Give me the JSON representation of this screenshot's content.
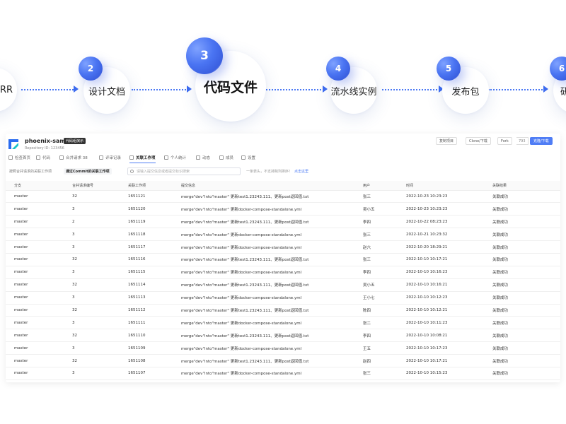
{
  "steps": [
    {
      "number": "",
      "label": "RR"
    },
    {
      "number": "2",
      "label": "设计文档"
    },
    {
      "number": "3",
      "label": "代码文件"
    },
    {
      "number": "4",
      "label": "流水线实例"
    },
    {
      "number": "5",
      "label": "发布包"
    },
    {
      "number": "6",
      "label": "研"
    }
  ],
  "repo": {
    "name": "phoenix-sample",
    "badge": "代码组演示",
    "id_text": "Repository ID: 123456"
  },
  "header_buttons": {
    "b1": "复制项目",
    "b2": "Clone/下载",
    "fork": "Fork",
    "fork_count": "793",
    "primary": "克隆/下载"
  },
  "tabs": [
    "检查首页",
    "代码",
    "合并请求 38",
    "评审记录",
    "关联工作项",
    "个人统计",
    "动态",
    "成员",
    "设置"
  ],
  "filters": {
    "seg1": "按照合并请求的关联工作项",
    "seg2": "通过Commit的关联工作项",
    "search_placeholder": "请输入提交信息或者提交标识搜索",
    "hint": "一条表头，不支持跨列排序！",
    "hint_link": "点击这里"
  },
  "table": {
    "columns": [
      "分支",
      "合并请求编号",
      "关联工作项",
      "提交信息",
      "用户",
      "时间",
      "关联结果"
    ],
    "rows": [
      [
        "master",
        "32",
        "1651121",
        "merge\"dev\"into\"master\" 更新test1.23243.111、更新post返回值.txt",
        "张三",
        "2022-10-23 10:23:23",
        "关联成功"
      ],
      [
        "master",
        "3",
        "1651120",
        "merge\"dev\"into\"master\" 更新docker-compose-standalone.yml",
        "吴小五",
        "2022-10-23 10:23:23",
        "关联成功"
      ],
      [
        "master",
        "2",
        "1651119",
        "merge\"dev\"into\"master\" 更新test1.23243.111、更新post返回值.txt",
        "李四",
        "2022-10-22 08:23:23",
        "关联成功"
      ],
      [
        "master",
        "3",
        "1651118",
        "merge\"dev\"into\"master\" 更新docker-compose-standalone.yml",
        "张三",
        "2022-10-21 10:23:32",
        "关联成功"
      ],
      [
        "master",
        "3",
        "1651117",
        "merge\"dev\"into\"master\" 更新docker-compose-standalone.yml",
        "赵六",
        "2022-10-20 18:29:21",
        "关联成功"
      ],
      [
        "master",
        "32",
        "1651116",
        "merge\"dev\"into\"master\" 更新test1.23243.111、更新post返回值.txt",
        "张三",
        "2022-10-10 10:17:21",
        "关联成功"
      ],
      [
        "master",
        "3",
        "1651115",
        "merge\"dev\"into\"master\" 更新docker-compose-standalone.yml",
        "李四",
        "2022-10-10 10:16:23",
        "关联成功"
      ],
      [
        "master",
        "32",
        "1651114",
        "merge\"dev\"into\"master\" 更新test1.23243.111、更新post返回值.txt",
        "吴小五",
        "2022-10-10 10:16:21",
        "关联成功"
      ],
      [
        "master",
        "3",
        "1651113",
        "merge\"dev\"into\"master\" 更新docker-compose-standalone.yml",
        "王小七",
        "2022-10-10 10:12:23",
        "关联成功"
      ],
      [
        "master",
        "32",
        "1651112",
        "merge\"dev\"into\"master\" 更新test1.23243.111、更新post返回值.txt",
        "陈四",
        "2022-10-10 10:12:21",
        "关联成功"
      ],
      [
        "master",
        "3",
        "1651111",
        "merge\"dev\"into\"master\" 更新docker-compose-standalone.yml",
        "张二",
        "2022-10-10 10:11:23",
        "关联成功"
      ],
      [
        "master",
        "32",
        "1651110",
        "merge\"dev\"into\"master\" 更新test1.23243.111、更新post返回值.txt",
        "李四",
        "2022-10-10 10:08:21",
        "关联成功"
      ],
      [
        "master",
        "3",
        "1651109",
        "merge\"dev\"into\"master\" 更新docker-compose-standalone.yml",
        "王五",
        "2022-10-10 10:17:23",
        "关联成功"
      ],
      [
        "master",
        "32",
        "1651108",
        "merge\"dev\"into\"master\" 更新test1.23243.111、更新post返回值.txt",
        "赵四",
        "2022-10-10 10:17:21",
        "关联成功"
      ],
      [
        "master",
        "3",
        "1651107",
        "merge\"dev\"into\"master\" 更新docker-compose-standalone.yml",
        "张三",
        "2022-10-10 10:15:23",
        "关联成功"
      ]
    ]
  },
  "colors": {
    "accent": "#4f7df5",
    "step_blue": "#3b5fe0"
  }
}
